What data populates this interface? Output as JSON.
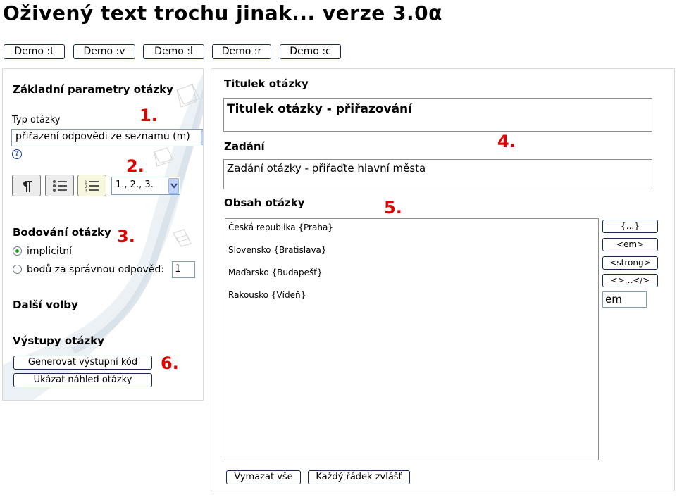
{
  "page": {
    "title": "Oživený text trochu jinak... verze 3.0α"
  },
  "demo_buttons": [
    "Demo :t",
    "Demo :v",
    "Demo :l",
    "Demo :r",
    "Demo :c"
  ],
  "left_panel": {
    "basic_params_heading": "Základní parametry otázky",
    "question_type_label": "Typ otázky",
    "question_type_value": "přiřazení odpovědi ze seznamu (m)",
    "help_icon": "question-mark-icon",
    "format_buttons": [
      {
        "icon": "pilcrow-icon"
      },
      {
        "icon": "bullet-list-icon"
      },
      {
        "icon": "numbered-list-icon",
        "active": true
      }
    ],
    "numbering_select_value": "1., 2., 3.",
    "scoring_heading": "Bodování otázky",
    "scoring_options": [
      {
        "label": "implicitní",
        "checked": true
      },
      {
        "label": "bodů za správnou odpověď:",
        "checked": false
      }
    ],
    "points_value": "1",
    "more_options_heading": "Další volby",
    "outputs_heading": "Výstupy otázky",
    "generate_button": "Generovat výstupní kód",
    "preview_button": "Ukázat náhled otázky"
  },
  "right_panel": {
    "title_label": "Titulek otázky",
    "title_value": "Titulek otázky - přiřazování",
    "assignment_label": "Zadání",
    "assignment_value": "Zadání otázky - přiřaďte hlavní města",
    "content_label": "Obsah otázky",
    "content_lines": [
      "Česká republika {Praha}",
      "Slovensko {Bratislava}",
      "Maďarsko {Budapešť}",
      "Rakousko {Vídeň}"
    ],
    "tag_buttons": [
      "{...}",
      "<em>",
      "<strong>",
      "<>...</>"
    ],
    "tag_input_value": "em",
    "clear_all_button": "Vymazat vše",
    "each_line_button": "Každý řádek zvlášť"
  },
  "annotations": [
    "1.",
    "2.",
    "3.",
    "4.",
    "5.",
    "6."
  ],
  "colors": {
    "annotation": "#e00000",
    "button_border": "#1a2c55",
    "radio_checked": "#21a121"
  }
}
